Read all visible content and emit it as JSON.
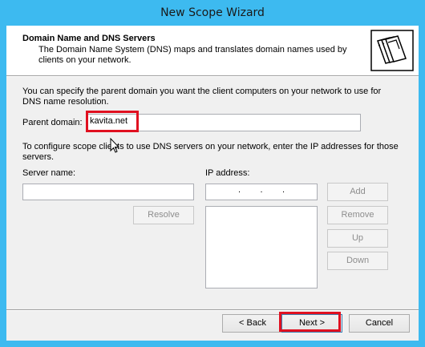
{
  "window": {
    "title": "New Scope Wizard"
  },
  "header": {
    "title": "Domain Name and DNS Servers",
    "subtitle": "The Domain Name System (DNS) maps and translates domain names used by clients on your network."
  },
  "body": {
    "intro": "You can specify the parent domain you want the client computers on your network to use for DNS name resolution.",
    "parent_domain_label": "Parent domain:",
    "parent_domain_value": "kavita.net",
    "configure_text": "To configure scope clients to use DNS servers on your network, enter the IP addresses for those servers.",
    "server_name_label": "Server name:",
    "ip_address_label": "IP address:",
    "ip_placeholder": ".        .        .",
    "resolve_label": "Resolve",
    "add_label": "Add",
    "remove_label": "Remove",
    "up_label": "Up",
    "down_label": "Down"
  },
  "footer": {
    "back_label": "< Back",
    "next_label": "Next >",
    "cancel_label": "Cancel"
  },
  "highlight_color": "#e01020"
}
